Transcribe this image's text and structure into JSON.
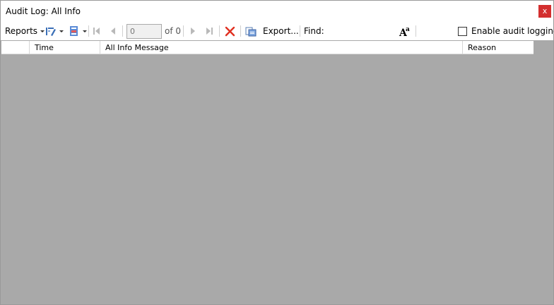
{
  "window": {
    "title": "Audit Log: All Info",
    "close_label": "x"
  },
  "toolbar": {
    "reports_label": "Reports",
    "page_value": "0",
    "page_of": "of 0",
    "export_label": "Export...",
    "find_label": "Find:",
    "enable_logging_label": "Enable audit logging",
    "enable_logging_checked": false,
    "delete_color": "#e03020"
  },
  "grid": {
    "columns": [
      "",
      "Time",
      "All Info Message",
      "Reason"
    ],
    "rows": []
  },
  "colors": {
    "grid_background": "#a9a9a9",
    "close_button": "#d32f2f"
  }
}
